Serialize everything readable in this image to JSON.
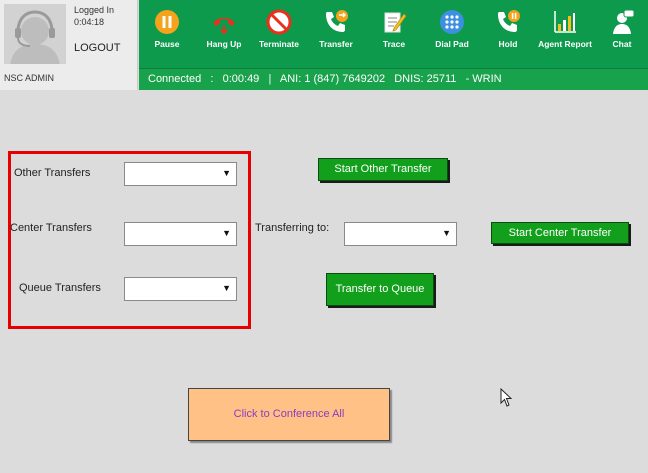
{
  "agent": {
    "logged_in_label": "Logged In",
    "logged_in_time": "0:04:18",
    "logout_label": "LOGOUT",
    "name": "NSC ADMIN"
  },
  "toolbar": {
    "items": [
      {
        "label": "Pause",
        "icon": "pause-icon",
        "color": "#f5a21c"
      },
      {
        "label": "Hang Up",
        "icon": "hang-up-icon",
        "color": "#e8301c"
      },
      {
        "label": "Terminate",
        "icon": "terminate-icon",
        "color": "#e8301c"
      },
      {
        "label": "Transfer",
        "icon": "transfer-icon",
        "color": "#ffffff"
      },
      {
        "label": "Trace",
        "icon": "trace-icon",
        "color": "#ffffff"
      },
      {
        "label": "Dial Pad",
        "icon": "dial-pad-icon",
        "color": "#3d8fe0"
      },
      {
        "label": "Hold",
        "icon": "hold-icon",
        "color": "#f5a21c"
      },
      {
        "label": "Agent Report",
        "icon": "agent-report-icon",
        "color": "#ffffff"
      },
      {
        "label": "Chat",
        "icon": "chat-icon",
        "color": "#ffffff"
      }
    ]
  },
  "status_bar": {
    "text": "Connected   :   0:00:49   |   ANI: 1 (847) 7649202   DNIS: 25711   - WRIN"
  },
  "transfers": {
    "other_label": "Other Transfers",
    "center_label": "Center Transfers",
    "queue_label": "Queue Transfers",
    "other_value": "",
    "center_value": "",
    "queue_value": "",
    "transferring_to_label": "Transferring to:",
    "transferring_to_value": "",
    "start_other_label": "Start Other Transfer",
    "start_center_label": "Start Center Transfer",
    "transfer_queue_label": "Transfer to Queue"
  },
  "conference": {
    "label": "Click to Conference All"
  },
  "colors": {
    "toolbar_green": "#0e9a4d",
    "status_green": "#19a24c",
    "button_green": "#12a01c",
    "highlight_red": "#e60000",
    "conference_orange": "#ffc185"
  }
}
